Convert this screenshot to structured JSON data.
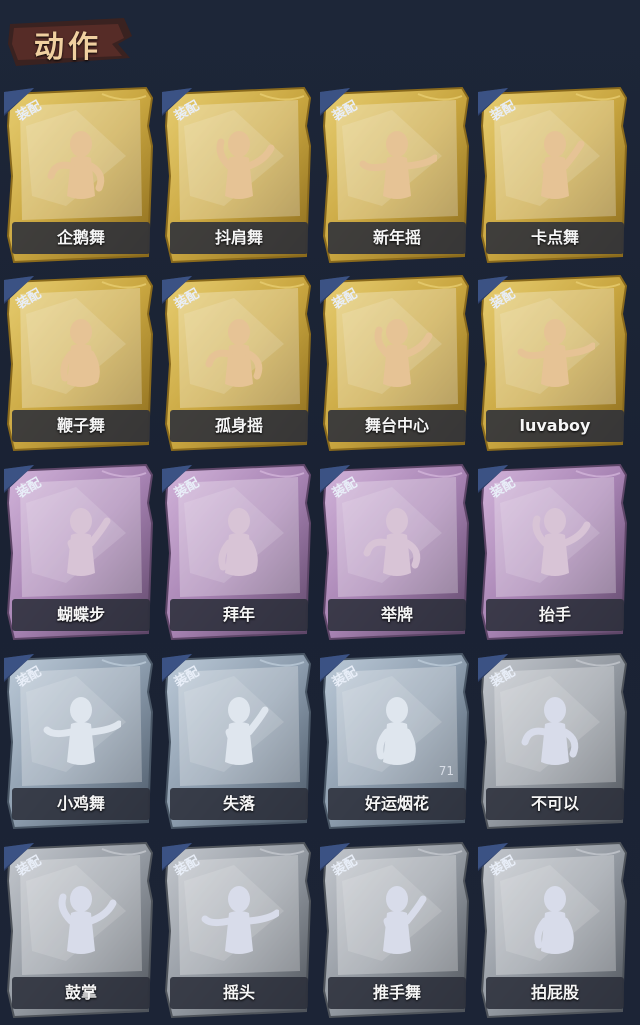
{
  "header": {
    "title": "动作"
  },
  "equip_label": "装配",
  "tiers": {
    "gold": {
      "base": "#c9a640",
      "light": "#e7cd70",
      "dark": "#8a6a1c",
      "icon": "#e6c395"
    },
    "purple": {
      "base": "#a783b3",
      "light": "#d2b4da",
      "dark": "#5e4668",
      "icon": "#d8c4d6"
    },
    "blue": {
      "base": "#8c9cad",
      "light": "#bccad8",
      "dark": "#4a5766",
      "icon": "#dfe6ee"
    },
    "gray": {
      "base": "#949aa2",
      "light": "#c4c8ce",
      "dark": "#4f545b",
      "icon": "#d8dcea"
    }
  },
  "actions": [
    {
      "name": "企鹅舞",
      "tier": "gold",
      "icon": "penguin-dance-icon"
    },
    {
      "name": "抖肩舞",
      "tier": "gold",
      "icon": "shoulder-shake-icon"
    },
    {
      "name": "新年摇",
      "tier": "gold",
      "icon": "new-year-shake-icon"
    },
    {
      "name": "卡点舞",
      "tier": "gold",
      "icon": "beat-dance-icon"
    },
    {
      "name": "鞭子舞",
      "tier": "gold",
      "icon": "whip-dance-icon"
    },
    {
      "name": "孤身摇",
      "tier": "gold",
      "icon": "solo-shake-icon"
    },
    {
      "name": "舞台中心",
      "tier": "gold",
      "icon": "center-stage-icon"
    },
    {
      "name": "luvaboy",
      "tier": "gold",
      "icon": "luvaboy-icon"
    },
    {
      "name": "蝴蝶步",
      "tier": "purple",
      "icon": "butterfly-step-icon"
    },
    {
      "name": "拜年",
      "tier": "purple",
      "icon": "new-year-greeting-icon"
    },
    {
      "name": "举牌",
      "tier": "purple",
      "icon": "hold-sign-icon"
    },
    {
      "name": "抬手",
      "tier": "purple",
      "icon": "raise-hand-icon"
    },
    {
      "name": "小鸡舞",
      "tier": "blue",
      "icon": "chicken-dance-icon"
    },
    {
      "name": "失落",
      "tier": "blue",
      "icon": "dejected-icon"
    },
    {
      "name": "好运烟花",
      "tier": "blue",
      "icon": "lucky-firework-icon",
      "count": "71"
    },
    {
      "name": "不可以",
      "tier": "gray",
      "icon": "no-finger-icon"
    },
    {
      "name": "鼓掌",
      "tier": "gray",
      "icon": "clap-icon"
    },
    {
      "name": "摇头",
      "tier": "gray",
      "icon": "head-shake-icon"
    },
    {
      "name": "推手舞",
      "tier": "gray",
      "icon": "push-hand-dance-icon"
    },
    {
      "name": "拍屁股",
      "tier": "gray",
      "icon": "butt-slap-icon"
    }
  ]
}
